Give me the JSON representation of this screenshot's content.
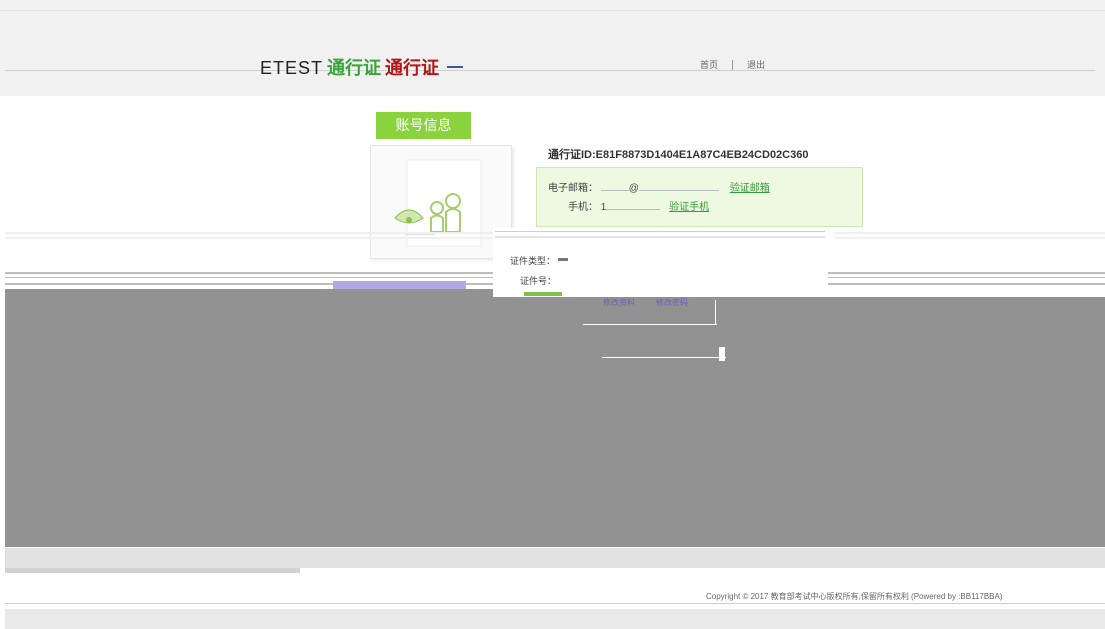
{
  "header": {
    "logo_etest": "ETEST",
    "logo_cn": "通行证",
    "logo_cn2": "通行证",
    "nav": [
      "首页",
      "退出"
    ]
  },
  "account": {
    "tab_label": "账号信息",
    "pass_id": "通行证ID:E81F8873D1404E1A87C4EB24CD02C360",
    "email_label": "电子邮箱：",
    "email_at": "@",
    "email_verify": "验证邮箱",
    "phone_label": "手机：",
    "phone_prefix": "1",
    "phone_verify": "验证手机",
    "id_type_label": "证件类型：",
    "id_num_label": "证件号：",
    "edit_profile": "修改资料",
    "change_password": "修改密码"
  },
  "footer": {
    "copyright": "Copyright © 2017 教育部考试中心版权所有,保留所有权利 (Powered by :BB117BBA)"
  },
  "colors": {
    "accent_green": "#8bd33d",
    "link_green": "#3a9a3a",
    "panel_gray": "#929292",
    "info_bg": "#eef9e2"
  }
}
